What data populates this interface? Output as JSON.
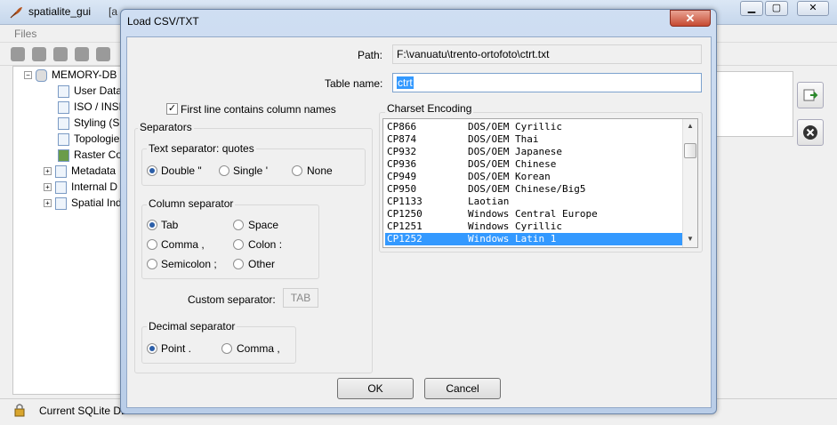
{
  "main_window": {
    "title": "spatialite_gui",
    "title_suffix": "[a",
    "menu_files": "Files",
    "tree": {
      "root": "MEMORY-DB",
      "items": [
        "User Data",
        "ISO / INSPIRE",
        "Styling (S",
        "Topologies",
        "Raster Co",
        "Metadata",
        "Internal D",
        "Spatial Ind"
      ]
    },
    "status_text": "Current SQLite DB"
  },
  "dialog": {
    "title": "Load CSV/TXT",
    "close_glyph": "✕",
    "path_label": "Path:",
    "path_value": "F:\\vanuatu\\trento-ortofoto\\ctrt.txt",
    "table_name_label": "Table name:",
    "table_name_value": "ctrt",
    "first_line_label": "First line contains column names",
    "first_line_checked": true,
    "separators_label": "Separators",
    "text_separator": {
      "title": "Text separator: quotes",
      "options": [
        "Double \"",
        "Single '",
        "None"
      ],
      "selected": "Double \""
    },
    "column_separator": {
      "title": "Column separator",
      "options": [
        "Tab",
        "Space",
        "Comma ,",
        "Colon :",
        "Semicolon ;",
        "Other"
      ],
      "selected": "Tab"
    },
    "custom_separator_label": "Custom separator:",
    "custom_separator_value": "TAB",
    "decimal_separator": {
      "title": "Decimal separator",
      "options": [
        "Point .",
        "Comma ,"
      ],
      "selected": "Point ."
    },
    "charset": {
      "title": "Charset Encoding",
      "rows": [
        {
          "code": "CP866",
          "name": "DOS/OEM Cyrillic"
        },
        {
          "code": "CP874",
          "name": "DOS/OEM Thai"
        },
        {
          "code": "CP932",
          "name": "DOS/OEM Japanese"
        },
        {
          "code": "CP936",
          "name": "DOS/OEM Chinese"
        },
        {
          "code": "CP949",
          "name": "DOS/OEM Korean"
        },
        {
          "code": "CP950",
          "name": "DOS/OEM Chinese/Big5"
        },
        {
          "code": "CP1133",
          "name": "Laotian"
        },
        {
          "code": "CP1250",
          "name": "Windows Central Europe"
        },
        {
          "code": "CP1251",
          "name": "Windows Cyrillic"
        },
        {
          "code": "CP1252",
          "name": "Windows Latin 1"
        }
      ],
      "selected": "CP1252"
    },
    "ok_label": "OK",
    "cancel_label": "Cancel"
  },
  "colors": {
    "selection": "#3399ff",
    "title_bar": "#c6d7ec",
    "close_button": "#c64a32"
  }
}
